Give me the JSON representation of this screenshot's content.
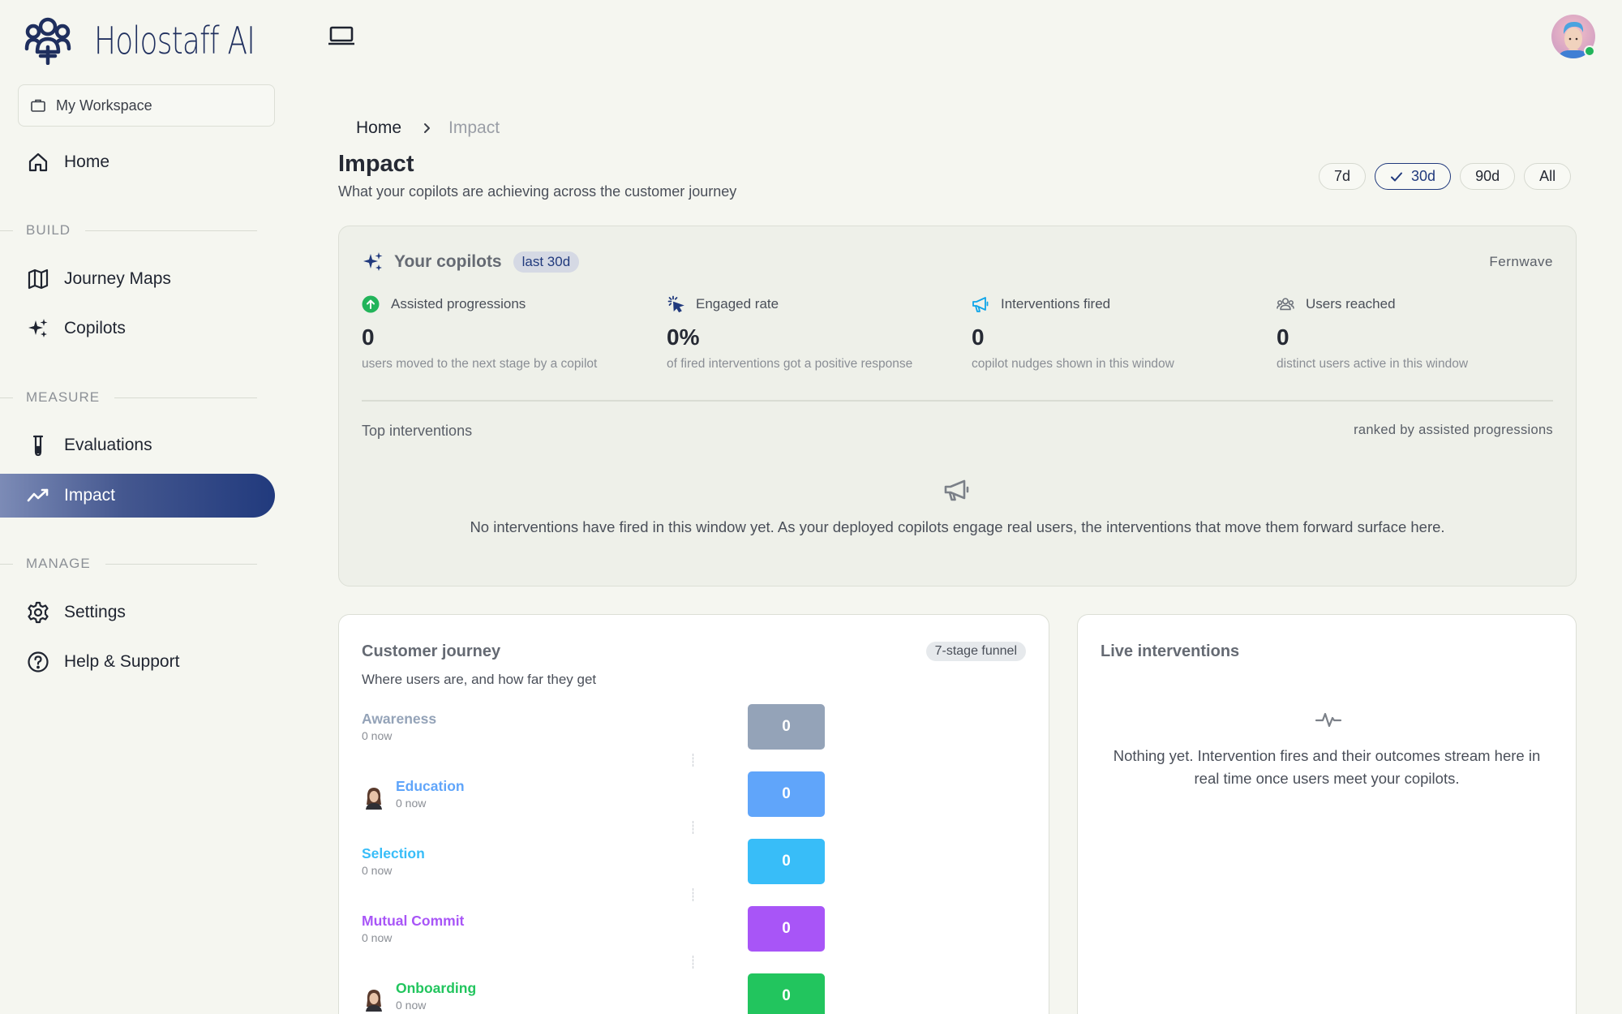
{
  "app": {
    "name": "Holostaff AI"
  },
  "sidebar": {
    "workspace": "My Workspace",
    "home": "Home",
    "sections": {
      "build": "BUILD",
      "measure": "MEASURE",
      "manage": "MANAGE"
    },
    "items": {
      "journey_maps": "Journey Maps",
      "copilots": "Copilots",
      "evaluations": "Evaluations",
      "impact": "Impact",
      "settings": "Settings",
      "help": "Help & Support"
    }
  },
  "breadcrumb": {
    "home": "Home",
    "current": "Impact"
  },
  "page": {
    "title": "Impact",
    "subtitle": "What your copilots are achieving across the customer journey"
  },
  "range": {
    "options": [
      "7d",
      "30d",
      "90d",
      "All"
    ],
    "selected": "30d"
  },
  "copilots": {
    "title": "Your copilots",
    "badge": "last 30d",
    "org": "Fernwave",
    "metrics": [
      {
        "label": "Assisted progressions",
        "value": "0",
        "desc": "users moved to the next stage by a copilot",
        "icon": "arrow-up-circle-icon"
      },
      {
        "label": "Engaged rate",
        "value": "0%",
        "desc": "of fired interventions got a positive response",
        "icon": "cursor-click-icon"
      },
      {
        "label": "Interventions fired",
        "value": "0",
        "desc": "copilot nudges shown in this window",
        "icon": "megaphone-icon"
      },
      {
        "label": "Users reached",
        "value": "0",
        "desc": "distinct users active in this window",
        "icon": "users-icon"
      }
    ],
    "top_interventions": {
      "label": "Top interventions",
      "rank_note": "ranked by assisted progressions",
      "empty": "No interventions have fired in this window yet. As your deployed copilots engage real users, the interventions that move them forward surface here."
    }
  },
  "journey": {
    "title": "Customer journey",
    "badge": "7-stage funnel",
    "subtitle": "Where users are, and how far they get",
    "stages": [
      {
        "name": "Awareness",
        "now": "0 now",
        "count": "0",
        "color": "#94a3b8",
        "avatar": false
      },
      {
        "name": "Education",
        "now": "0 now",
        "count": "0",
        "color": "#60a5fa",
        "avatar": true
      },
      {
        "name": "Selection",
        "now": "0 now",
        "count": "0",
        "color": "#38bdf8",
        "avatar": false
      },
      {
        "name": "Mutual Commit",
        "now": "0 now",
        "count": "0",
        "color": "#a855f7",
        "avatar": false
      },
      {
        "name": "Onboarding",
        "now": "0 now",
        "count": "0",
        "color": "#22c55e",
        "avatar": true
      }
    ]
  },
  "live": {
    "title": "Live interventions",
    "empty": "Nothing yet. Intervention fires and their outcomes stream here in real time once users meet your copilots."
  },
  "colors": {
    "accent": "#213a7d",
    "success": "#22b45a",
    "info": "#0ea5e9"
  }
}
